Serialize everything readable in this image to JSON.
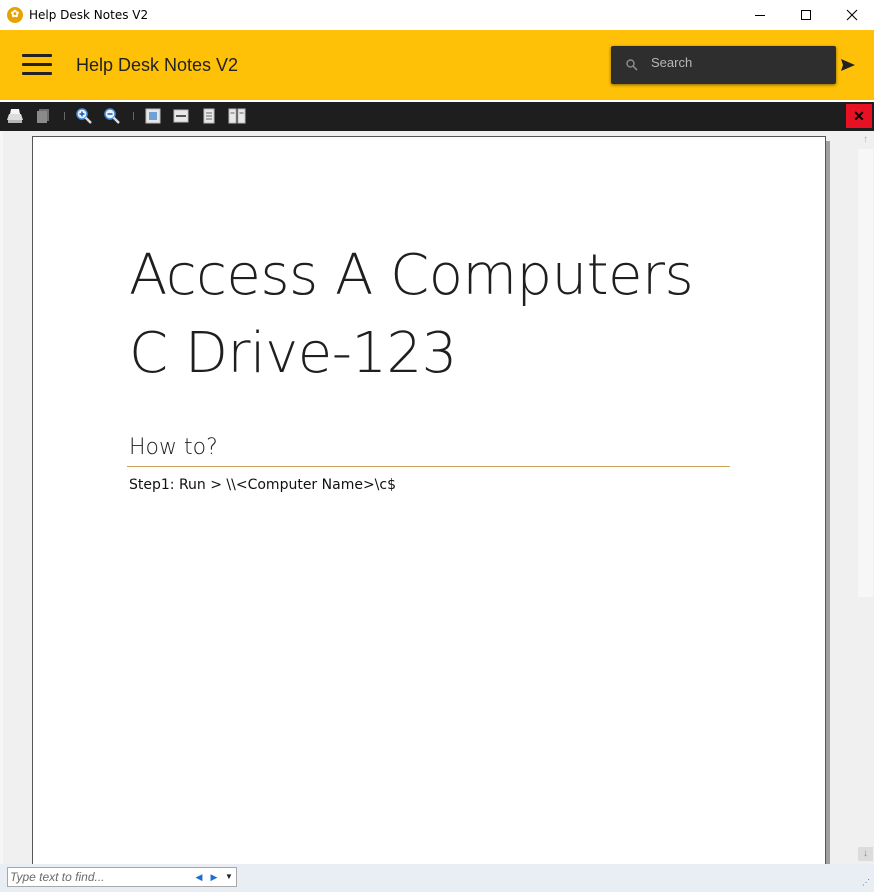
{
  "window": {
    "title": "Help Desk Notes V2",
    "icon": "app-logo-icon",
    "controls": {
      "minimize": "minimize-icon",
      "maximize": "maximize-icon",
      "close": "close-icon"
    }
  },
  "header": {
    "title": "Help Desk Notes V2",
    "menu_icon": "hamburger-menu-icon",
    "search": {
      "placeholder": "Search",
      "icon": "search-icon"
    },
    "send_icon": "send-icon",
    "accent_color": "#ffc107"
  },
  "toolbar": {
    "buttons": [
      {
        "name": "print",
        "icon": "print-icon"
      },
      {
        "name": "copy",
        "icon": "copy-icon"
      },
      {
        "name": "zoom-in",
        "icon": "zoom-in-icon"
      },
      {
        "name": "zoom-out",
        "icon": "zoom-out-icon"
      },
      {
        "name": "whole-page",
        "icon": "whole-page-icon"
      },
      {
        "name": "page-width",
        "icon": "page-width-icon"
      },
      {
        "name": "one-page",
        "icon": "one-page-icon"
      },
      {
        "name": "two-pages",
        "icon": "two-pages-icon"
      }
    ],
    "close_label": "✕",
    "close_color": "#e81123"
  },
  "document": {
    "title": "Access A Computers C Drive-123",
    "heading": "How to?",
    "step": "Step1: Run > \\\\<Computer Name>\\c$",
    "rule_color": "#c9a45a"
  },
  "findbar": {
    "placeholder": "Type text to find...",
    "prev_icon": "find-previous-icon",
    "next_icon": "find-next-icon",
    "menu_icon": "dropdown-arrow-icon"
  }
}
